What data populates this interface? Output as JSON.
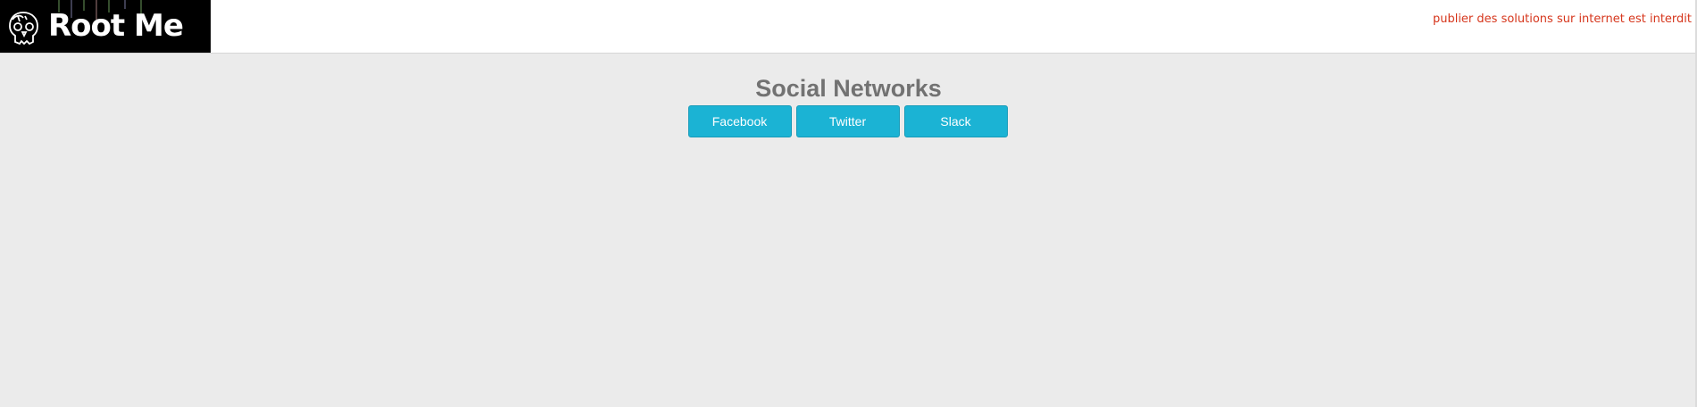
{
  "header": {
    "logo_text": "Root Me",
    "notice": "publier des solutions sur internet est interdit"
  },
  "main": {
    "title": "Social Networks",
    "buttons": [
      {
        "label": "Facebook"
      },
      {
        "label": "Twitter"
      },
      {
        "label": "Slack"
      }
    ]
  },
  "colors": {
    "page_background": "#ebebeb",
    "header_background": "#ffffff",
    "logo_background": "#000000",
    "notice_text": "#d6361c",
    "title_text": "#727272",
    "button_background": "#1bb3d4",
    "button_text": "#ffffff"
  }
}
